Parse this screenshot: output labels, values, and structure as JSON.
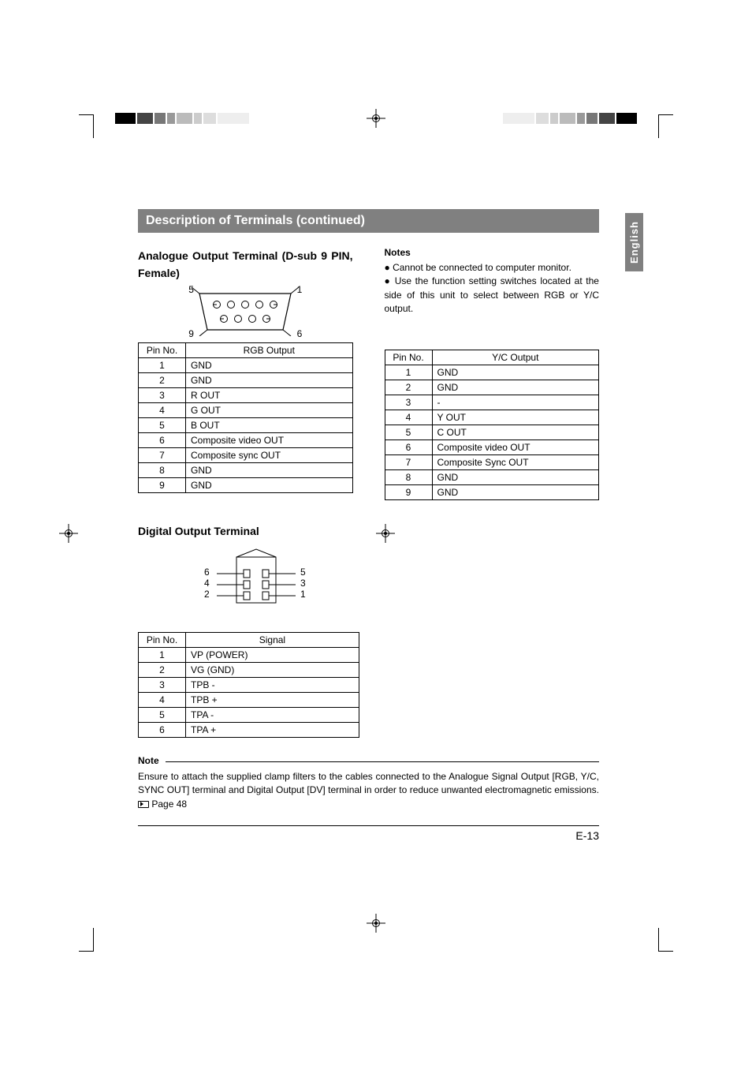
{
  "sideTab": "English",
  "header": "Description of Terminals (continued)",
  "section1": {
    "title": "Analogue Output Terminal (D-sub 9 PIN, Female)",
    "dsubLabels": {
      "tl": "5",
      "tr": "1",
      "bl": "9",
      "br": "6"
    },
    "rgbTable": {
      "headers": [
        "Pin No.",
        "RGB Output"
      ],
      "rows": [
        [
          "1",
          "GND"
        ],
        [
          "2",
          "GND"
        ],
        [
          "3",
          "R OUT"
        ],
        [
          "4",
          "G OUT"
        ],
        [
          "5",
          "B OUT"
        ],
        [
          "6",
          "Composite video OUT"
        ],
        [
          "7",
          "Composite sync OUT"
        ],
        [
          "8",
          "GND"
        ],
        [
          "9",
          "GND"
        ]
      ]
    },
    "notesHead": "Notes",
    "notes": [
      "Cannot be connected to computer monitor.",
      "Use the function setting switches located at the side of this unit to select between RGB or Y/C output."
    ],
    "ycTable": {
      "headers": [
        "Pin No.",
        "Y/C Output"
      ],
      "rows": [
        [
          "1",
          "GND"
        ],
        [
          "2",
          "GND"
        ],
        [
          "3",
          "-"
        ],
        [
          "4",
          "Y OUT"
        ],
        [
          "5",
          "C OUT"
        ],
        [
          "6",
          "Composite video OUT"
        ],
        [
          "7",
          "Composite Sync OUT"
        ],
        [
          "8",
          "GND"
        ],
        [
          "9",
          "GND"
        ]
      ]
    }
  },
  "section2": {
    "title": "Digital Output Terminal",
    "figLabels": {
      "l_top": "6",
      "l_mid": "4",
      "l_bot": "2",
      "r_top": "5",
      "r_mid": "3",
      "r_bot": "1"
    },
    "table": {
      "headers": [
        "Pin No.",
        "Signal"
      ],
      "rows": [
        [
          "1",
          "VP (POWER)"
        ],
        [
          "2",
          "VG (GND)"
        ],
        [
          "3",
          "TPB -"
        ],
        [
          "4",
          "TPB +"
        ],
        [
          "5",
          "TPA -"
        ],
        [
          "6",
          "TPA +"
        ]
      ]
    }
  },
  "note": {
    "label": "Note",
    "body": "Ensure to attach the supplied clamp filters to the cables connected to the Analogue Signal Output [RGB, Y/C, SYNC OUT] terminal and Digital Output [DV] terminal in order to reduce unwanted electromagnetic emissions. ",
    "ref": "Page 48"
  },
  "pageNum": "E-13"
}
